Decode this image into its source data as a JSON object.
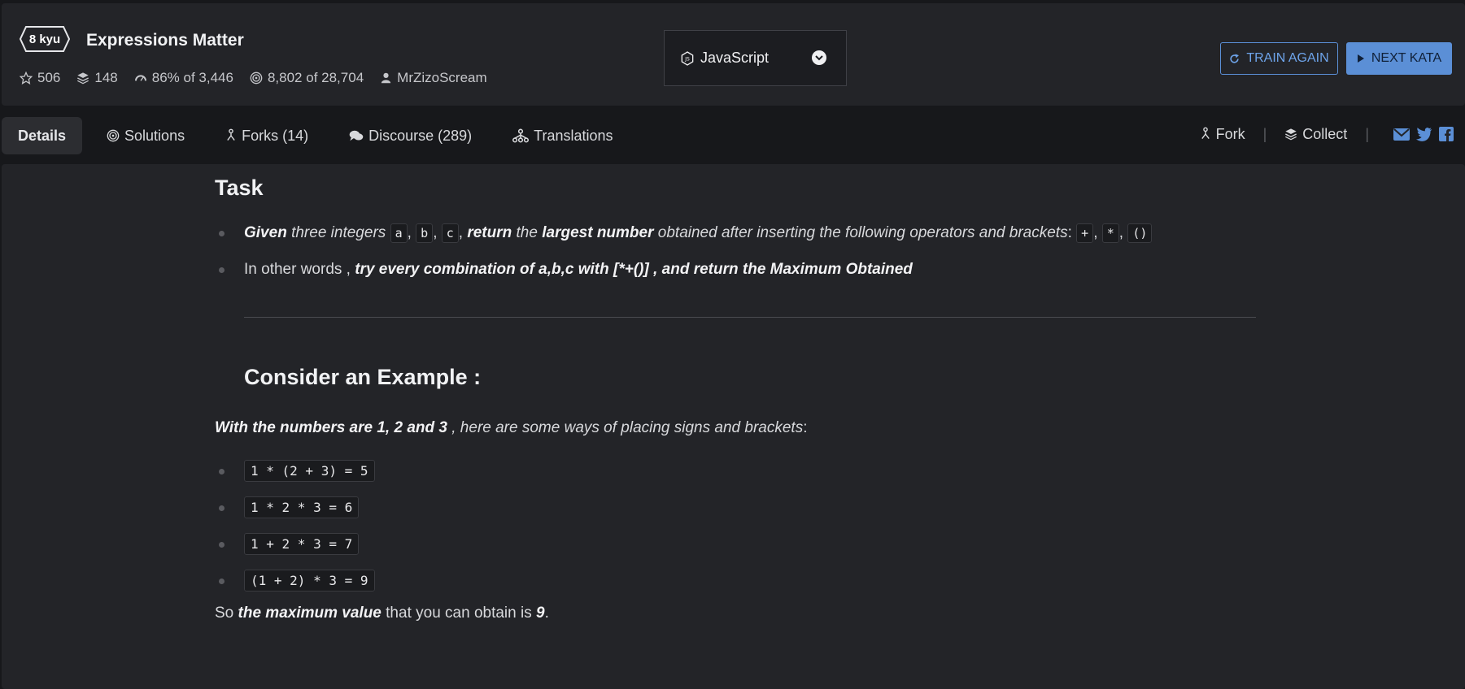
{
  "header": {
    "kyu": "8 kyu",
    "title": "Expressions Matter",
    "stats": {
      "stars": "506",
      "collections": "148",
      "satisfaction": "86%",
      "satisfaction_suffix": "of 3,446",
      "completed": "8,802",
      "completed_suffix": "of 28,704",
      "author": "MrZizoScream"
    },
    "language": "JavaScript",
    "train_again": "TRAIN AGAIN",
    "next_kata": "NEXT KATA",
    "accent_color": "#5b8fd6"
  },
  "tabs": [
    {
      "label": "Details",
      "icon": "info",
      "active": true
    },
    {
      "label": "Solutions",
      "icon": "target-icon"
    },
    {
      "label": "Forks (14)",
      "icon": "fork-icon"
    },
    {
      "label": "Discourse (289)",
      "icon": "chat-icon"
    },
    {
      "label": "Translations",
      "icon": "translate-icon"
    }
  ],
  "actions": {
    "fork": "Fork",
    "collect": "Collect",
    "sep": "|"
  },
  "description": {
    "task_heading": "Task",
    "bullet1": {
      "given": "Given",
      "t1": " three integers ",
      "a": "a",
      "comma": ",",
      "b": "b",
      "c": "c",
      "return": "return",
      "the": " the ",
      "largest": "largest number",
      "t2": " obtained after inserting the following operators and brackets",
      "colon": ":",
      "op_plus": "+",
      "op_mul": "*",
      "op_paren": "()"
    },
    "bullet2": {
      "prefix": "In other words , ",
      "bold": "try every combination of a,b,c with [*+()] , and return the Maximum Obtained"
    },
    "example_heading": "Consider an Example :",
    "example_intro_bold": "With the numbers are 1, 2 and 3",
    "example_intro_rest": " , here are some ways of placing signs and brackets",
    "examples": [
      "1 * (2 + 3) = 5",
      "1 * 2 * 3 = 6",
      "1 + 2 * 3 = 7",
      "(1 + 2) * 3 = 9"
    ],
    "final_so": "So ",
    "final_bold": "the maximum value",
    "final_mid": " that you can obtain is ",
    "final_value": "9",
    "final_end": "."
  }
}
